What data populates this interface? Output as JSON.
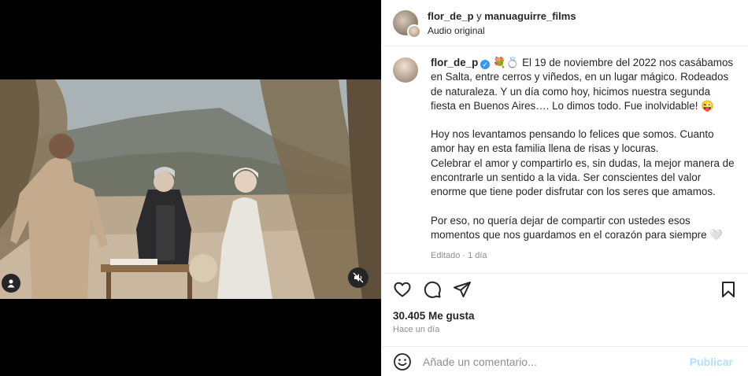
{
  "header": {
    "author": "flor_de_p",
    "connector": " y ",
    "coauthor": "manuaguirre_films",
    "audio": "Audio original"
  },
  "caption": {
    "username": "flor_de_p",
    "verified_glyph": "✓",
    "emojis": "💐💍",
    "paragraph1": "El 19 de noviembre del 2022 nos casábamos en Salta, entre cerros y viñedos, en un lugar mágico. Rodeados de naturaleza. Y un día como hoy, hicimos nuestra segunda fiesta en Buenos Aires…. Lo dimos todo. Fue inolvidable! 😜",
    "paragraph2": "Hoy nos levantamos pensando lo felices que somos. Cuanto amor hay en esta familia llena de risas y locuras.\nCelebrar el amor y compartirlo es, sin dudas, la mejor manera de encontrarle un sentido a la vida. Ser conscientes del valor enorme que tiene poder disfrutar con los seres que amamos.",
    "paragraph3": "Por eso, no quería dejar de compartir con ustedes esos momentos que nos guardamos en el corazón para siempre 🤍",
    "meta": "Editado · 1 día"
  },
  "actions": {
    "icons": [
      "heart-icon",
      "comment-icon",
      "share-icon",
      "bookmark-icon"
    ]
  },
  "stats": {
    "likes": "30.405 Me gusta",
    "time": "Hace un día"
  },
  "comment": {
    "placeholder": "Añade un comentario...",
    "publish": "Publicar"
  },
  "colors": {
    "verified": "#3897f0",
    "publish_disabled": "#b2dffc",
    "muted_text": "#8e8e8e"
  }
}
